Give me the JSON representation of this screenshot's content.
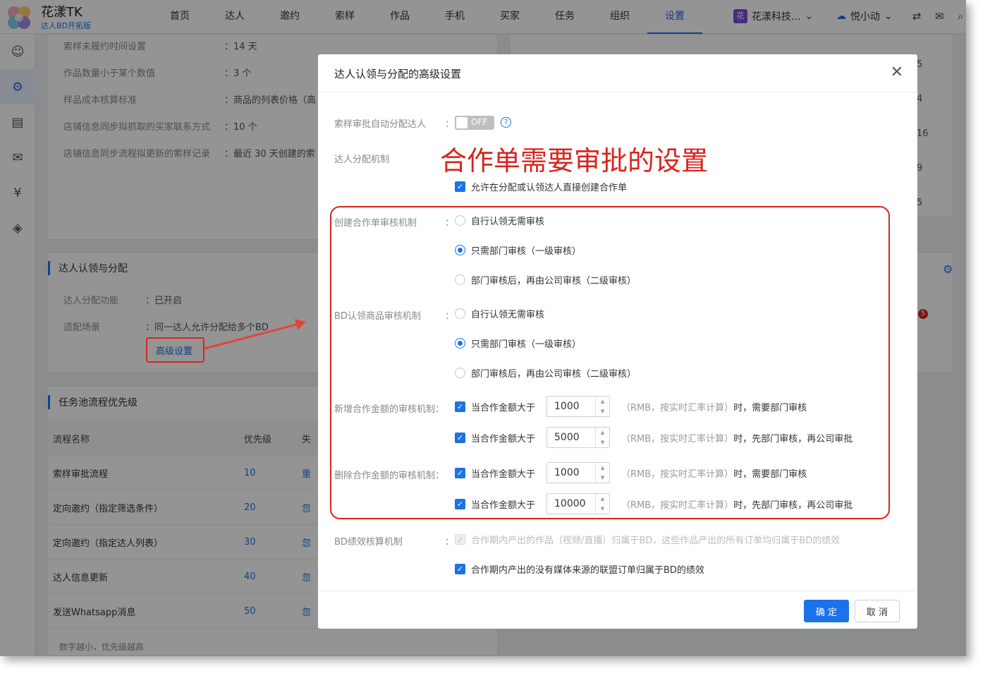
{
  "brand": {
    "name": "花漾TK",
    "subtitle": "达人BD开拓版"
  },
  "nav": [
    "首页",
    "达人",
    "邀约",
    "索样",
    "作品",
    "手机",
    "买家",
    "任务",
    "组织",
    "设置"
  ],
  "org_name": "花漾科技...",
  "org_badge": "花",
  "user_name": "悦小动",
  "bg": {
    "kv": [
      {
        "k": "索样未履约时间设置",
        "v": "14 天"
      },
      {
        "k": "作品数量小于某个数值",
        "v": "3 个"
      },
      {
        "k": "样品成本核算标准",
        "v": "商品的列表价格（高"
      },
      {
        "k": "店铺信息同步拟抓取的买家联系方式",
        "v": "10 个"
      },
      {
        "k": "店铺信息同步流程拟更新的索样记录",
        "v": "最近 30 天创建的索"
      }
    ],
    "claim_section_title": "达人认领与分配",
    "claim_kv": [
      {
        "k": "达人分配功能",
        "v": "已开启"
      },
      {
        "k": "适配场景",
        "v": "同一达人允许分配给多个BD"
      }
    ],
    "advanced_link": "高级设置",
    "task_section_title": "任务池流程优先级",
    "table_head": [
      "流程名称",
      "优先级",
      "失"
    ],
    "table_rows": [
      {
        "name": "索样审批流程",
        "priority": "10",
        "action": "重"
      },
      {
        "name": "定向邀约（指定筛选条件）",
        "priority": "20",
        "action": "忽"
      },
      {
        "name": "定向邀约（指定达人列表）",
        "priority": "30",
        "action": "忽"
      },
      {
        "name": "达人信息更新",
        "priority": "40",
        "action": "忽"
      },
      {
        "name": "发送Whatsapp消息",
        "priority": "50",
        "action": "忽"
      }
    ],
    "footnote": "数字越小，优先级越高",
    "right_nums": [
      "5",
      "4",
      "16",
      "9",
      "5"
    ],
    "badge_count": "5"
  },
  "modal": {
    "title": "达人认领与分配的高级设置",
    "auto_assign_label": "索样审批自动分配达人",
    "toggle_text": "OFF",
    "mechanism_label": "达人分配机制",
    "annotation": "合作单需要审批的设置",
    "allow_create": "允许在分配或认领达人直接创建合作单",
    "create_label": "创建合作单审核机制",
    "bd_label": "BD认领商品审核机制",
    "options": [
      "自行认领无需审核",
      "只需部门审核（一级审核）",
      "部门审核后，再由公司审核（二级审核）"
    ],
    "add_label": "新增合作金额的审核机制",
    "delete_label": "删除合作金额的审核机制",
    "amount_prefix": "当合作金额大于",
    "hint_unit": "（RMB，按实时汇率计算）",
    "hint_when": "时，",
    "hint_dept": "需要部门审核",
    "hint_both": "先部门审核，再公司审批",
    "amounts": [
      "1000",
      "5000",
      "1000",
      "10000"
    ],
    "perf_label": "BD绩效核算机制",
    "perf_opt1": "合作期内产出的作品（视频/直播）归属于BD，这些作品产出的所有订单均归属于BD的绩效",
    "perf_opt2": "合作期内产出的没有媒体来源的联盟订单归属于BD的绩效",
    "confirm": "确 定",
    "cancel": "取 消"
  }
}
